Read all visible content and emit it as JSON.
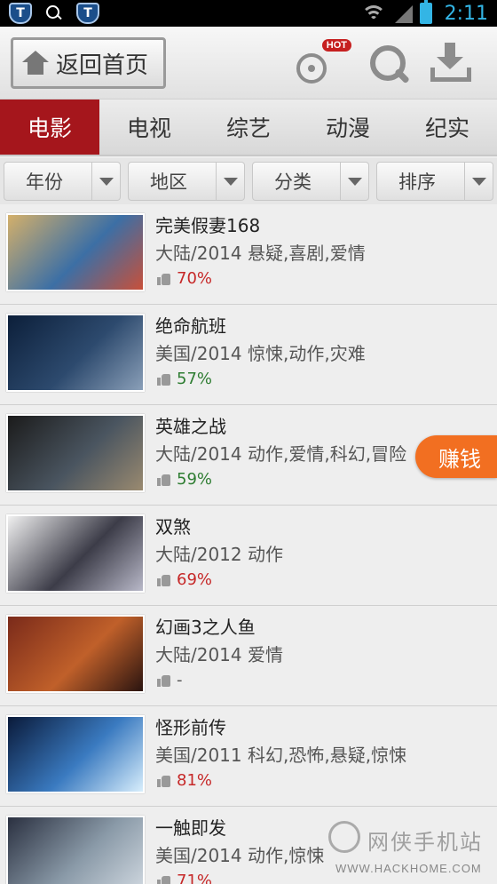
{
  "status_bar": {
    "time": "2:11"
  },
  "header": {
    "back_label": "返回首页",
    "hot_badge": "HOT"
  },
  "tabs": [
    {
      "label": "电影",
      "active": true
    },
    {
      "label": "电视",
      "active": false
    },
    {
      "label": "综艺",
      "active": false
    },
    {
      "label": "动漫",
      "active": false
    },
    {
      "label": "纪实",
      "active": false
    }
  ],
  "filters": [
    "年份",
    "地区",
    "分类",
    "排序"
  ],
  "movies": [
    {
      "title": "完美假妻168",
      "meta": "大陆/2014  悬疑,喜剧,爱情",
      "rating": "70%",
      "rating_color": "#c62828",
      "poster_colors": [
        "#d4b06a",
        "#3c6fa5",
        "#c8503a"
      ]
    },
    {
      "title": "绝命航班",
      "meta": "美国/2014  惊悚,动作,灾难",
      "rating": "57%",
      "rating_color": "#2e7d32",
      "poster_colors": [
        "#0c1f3a",
        "#2d4a6e",
        "#8a9fb8"
      ]
    },
    {
      "title": "英雄之战",
      "meta": "大陆/2014  动作,爱情,科幻,冒险",
      "rating": "59%",
      "rating_color": "#2e7d32",
      "poster_colors": [
        "#1b1b1b",
        "#4a5560",
        "#9a8a70"
      ]
    },
    {
      "title": "双煞",
      "meta": "大陆/2012  动作",
      "rating": "69%",
      "rating_color": "#c62828",
      "poster_colors": [
        "#f0f0f0",
        "#3c3c48",
        "#b8b8c8"
      ]
    },
    {
      "title": "幻画3之人鱼",
      "meta": "大陆/2014  爱情",
      "rating": "-",
      "rating_color": "#555555",
      "poster_colors": [
        "#7a2a1a",
        "#c0602a",
        "#2a1410"
      ]
    },
    {
      "title": "怪形前传",
      "meta": "美国/2011  科幻,恐怖,悬疑,惊悚",
      "rating": "81%",
      "rating_color": "#c62828",
      "poster_colors": [
        "#0a1a3a",
        "#3a7ac0",
        "#d8eefc"
      ]
    },
    {
      "title": "一触即发",
      "meta": "美国/2014  动作,惊悚",
      "rating": "71%",
      "rating_color": "#c62828",
      "poster_colors": [
        "#2a3040",
        "#8a9aa8",
        "#d0d8e0"
      ]
    }
  ],
  "earn_button": "赚钱",
  "watermark": {
    "text": "网侠手机站",
    "url": "WWW.HACKHOME.COM"
  },
  "colors": {
    "accent_red": "#a5161c",
    "earn_orange": "#f26f21"
  }
}
